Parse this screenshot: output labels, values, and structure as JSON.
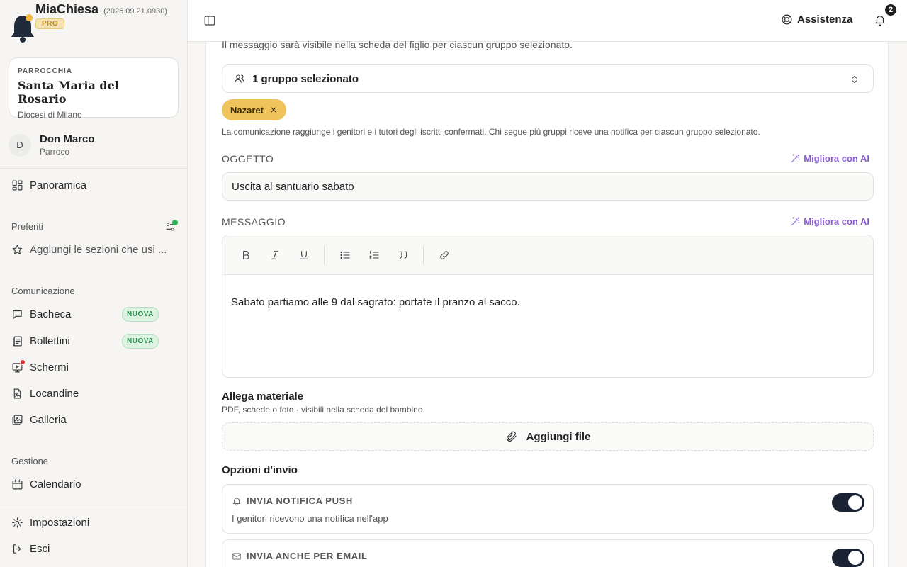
{
  "app": {
    "name": "MiaChiesa",
    "version": "(2026.09.21.0930)",
    "plan_badge": "PRO"
  },
  "parish": {
    "label": "PARROCCHIA",
    "name": "Santa Maria del Rosario",
    "diocese": "Diocesi di Milano"
  },
  "user": {
    "initial": "D",
    "name": "Don Marco",
    "role": "Parroco"
  },
  "sidebar": {
    "overview": "Panoramica",
    "favorites_label": "Preferiti",
    "favorites_hint": "Aggiungi le sezioni che usi ...",
    "communication_label": "Comunicazione",
    "communication_items": [
      {
        "label": "Bacheca",
        "icon": "message-square-icon",
        "badge": "NUOVA"
      },
      {
        "label": "Bollettini",
        "icon": "newspaper-icon",
        "badge": "NUOVA"
      },
      {
        "label": "Schermi",
        "icon": "monitor-icon",
        "badge": ""
      },
      {
        "label": "Locandine",
        "icon": "file-image-icon",
        "badge": ""
      },
      {
        "label": "Galleria",
        "icon": "images-icon",
        "badge": ""
      }
    ],
    "management_label": "Gestione",
    "calendar": "Calendario",
    "settings": "Impostazioni",
    "logout": "Esci"
  },
  "topbar": {
    "help_label": "Assistenza",
    "notification_count": "2"
  },
  "form": {
    "group_note": "Il messaggio sarà visibile nella scheda del figlio per ciascun gruppo selezionato.",
    "group_select": "1 gruppo selezionato",
    "selected_groups": [
      "Nazaret"
    ],
    "group_help": "La comunicazione raggiunge i genitori e i tutori degli iscritti confermati. Chi segue più gruppi riceve una notifica per ciascun gruppo selezionato.",
    "subject_label": "OGGETTO",
    "subject_value": "Uscita al santuario sabato",
    "ai_button": "Migliora con AI",
    "message_label": "MESSAGGIO",
    "message_body": "Sabato partiamo alle 9 dal sagrato: portate il pranzo al sacco.",
    "attach_title": "Allega materiale",
    "attach_sub": "PDF, schede o foto · visibili nella scheda del bambino.",
    "attach_button": "Aggiungi file",
    "options_title": "Opzioni d'invio",
    "options": [
      {
        "title": "INVIA NOTIFICA PUSH",
        "desc": "I genitori ricevono una notifica nell'app",
        "enabled": true,
        "icon": "bell-icon"
      },
      {
        "title": "INVIA ANCHE PER EMAIL",
        "desc": "",
        "enabled": true,
        "icon": "mail-icon"
      }
    ]
  },
  "colors": {
    "accent_ai": "#8a5cd1",
    "chip": "#f0c45c",
    "switch_on": "#1a2333",
    "badge_new": "#2e8b4f"
  }
}
